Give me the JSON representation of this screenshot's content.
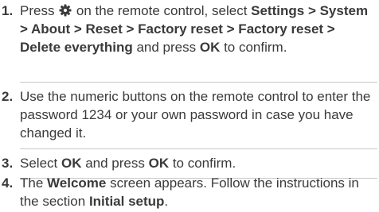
{
  "steps": [
    {
      "number": "1.",
      "segments": [
        {
          "text": "Press ",
          "bold": false
        },
        {
          "icon": "gear-icon"
        },
        {
          "text": " on the remote control, select ",
          "bold": false
        },
        {
          "text": "Settings",
          "bold": true
        },
        {
          "text": " ",
          "bold": false
        },
        {
          "text": "> System > About > Reset > Factory reset > Factory reset > Delete everything",
          "bold": true
        },
        {
          "text": " and press ",
          "bold": false
        },
        {
          "text": "OK",
          "bold": true
        },
        {
          "text": " to confirm.",
          "bold": false
        }
      ]
    },
    {
      "number": "2.",
      "segments": [
        {
          "text": "Use the numeric buttons on the remote control to enter the password 1234 or your own password in case you have changed it.",
          "bold": false
        }
      ]
    },
    {
      "number": "3.",
      "segments": [
        {
          "text": "Select ",
          "bold": false
        },
        {
          "text": "OK",
          "bold": true
        },
        {
          "text": " and press ",
          "bold": false
        },
        {
          "text": "OK",
          "bold": true
        },
        {
          "text": " to confirm.",
          "bold": false
        }
      ]
    },
    {
      "number": "4.",
      "segments": [
        {
          "text": "The ",
          "bold": false
        },
        {
          "text": "Welcome",
          "bold": true
        },
        {
          "text": " screen appears. Follow the instructions in the section ",
          "bold": false
        },
        {
          "text": "Initial setup",
          "bold": true
        },
        {
          "text": ".",
          "bold": false
        }
      ]
    }
  ],
  "colors": {
    "text": "#3a3a3a",
    "divider": "#c8c8c8"
  }
}
